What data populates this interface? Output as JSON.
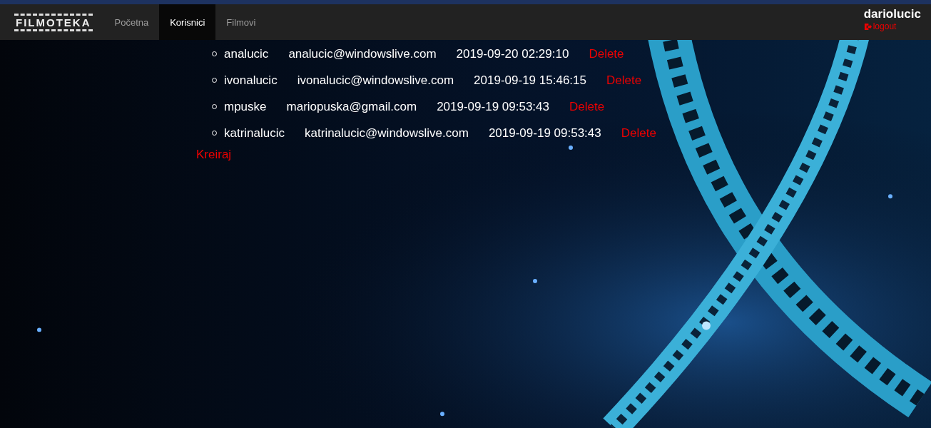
{
  "navbar": {
    "brand": "FILMOTEKA",
    "links": [
      {
        "label": "Početna",
        "selected": false
      },
      {
        "label": "Korisnici",
        "selected": true
      },
      {
        "label": "Filmovi",
        "selected": false
      }
    ],
    "user": {
      "name": "dariolucic",
      "logout": "logout"
    }
  },
  "users": [
    {
      "username": "analucic",
      "email": "analucic@windowslive.com",
      "created": "2019-09-20 02:29:10",
      "action": "Delete"
    },
    {
      "username": "ivonalucic",
      "email": "ivonalucic@windowslive.com",
      "created": "2019-09-19 15:46:15",
      "action": "Delete"
    },
    {
      "username": "mpuske",
      "email": "mariopuska@gmail.com",
      "created": "2019-09-19 09:53:43",
      "action": "Delete"
    },
    {
      "username": "katrinalucic",
      "email": "katrinalucic@windowslive.com",
      "created": "2019-09-19 09:53:43",
      "action": "Delete"
    }
  ],
  "create_link": "Kreiraj"
}
